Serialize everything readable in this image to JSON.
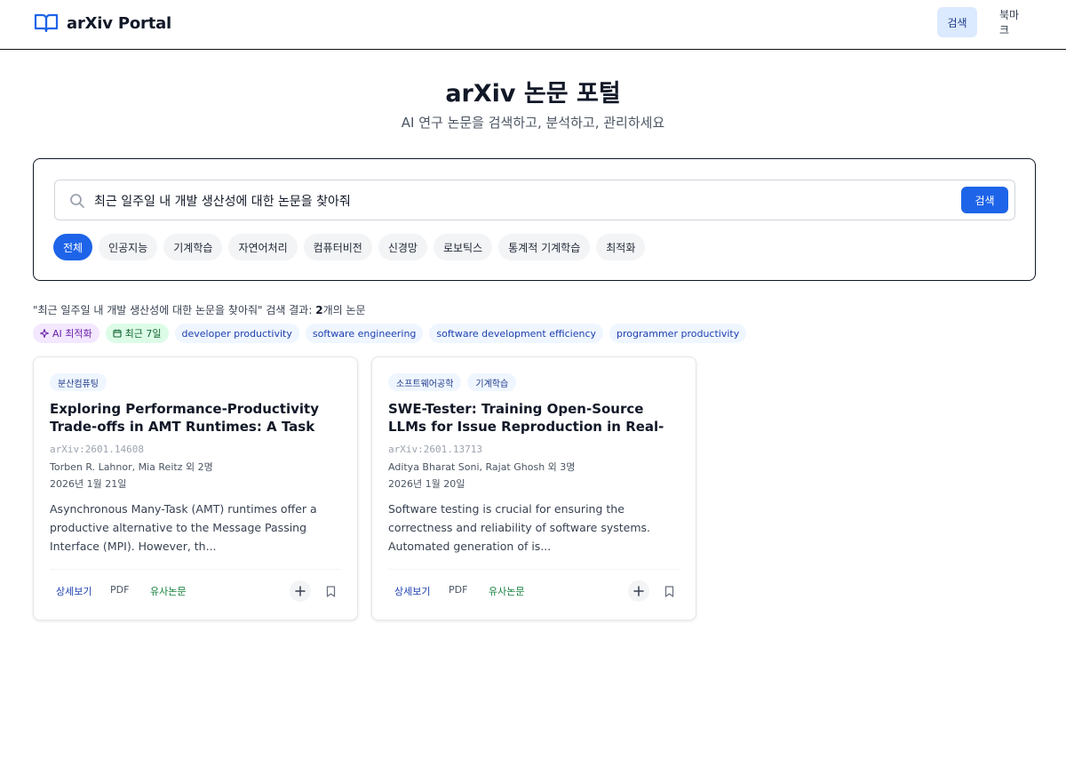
{
  "header": {
    "brand": "arXiv Portal",
    "nav": [
      {
        "label": "검색",
        "active": true
      },
      {
        "label": "북마크",
        "active": false
      }
    ]
  },
  "hero": {
    "title": "arXiv 논문 포털",
    "subtitle": "AI 연구 논문을 검색하고, 분석하고, 관리하세요"
  },
  "search": {
    "query": "최근 일주일 내 개발 생산성에 대한 논문을 찾아줘",
    "button_label": "검색",
    "categories": [
      "전체",
      "인공지능",
      "기계학습",
      "자연어처리",
      "컴퓨터비전",
      "신경망",
      "로보틱스",
      "통계적 기계학습",
      "최적화"
    ],
    "active_category": "전체"
  },
  "results": {
    "summary_prefix": "\"최근 일주일 내 개발 생산성에 대한 논문을 찾아줘\" 검색 결과: ",
    "count": "2",
    "summary_suffix": "개의 논문",
    "chips": {
      "ai": "AI 최적화",
      "date": "최근 7일",
      "keywords": [
        "developer productivity",
        "software engineering",
        "software development efficiency",
        "programmer productivity"
      ]
    }
  },
  "papers": [
    {
      "tags": [
        "분산컴퓨팅"
      ],
      "title": "Exploring Performance-Productivity Trade-offs in AMT Runtimes: A Task Bench Study …",
      "id": "arXiv:2601.14608",
      "authors": "Torben R. Lahnor, Mia Reitz 외 2명",
      "date": "2026년 1월 21일",
      "abstract": "Asynchronous Many-Task (AMT) runtimes offer a productive alternative to the Message Passing Interface (MPI). However, th...",
      "actions": {
        "detail": "상세보기",
        "pdf": "PDF",
        "similar": "유사논문"
      }
    },
    {
      "tags": [
        "소프트웨어공학",
        "기계학습"
      ],
      "title": "SWE-Tester: Training Open-Source LLMs for Issue Reproduction in Real-World…",
      "id": "arXiv:2601.13713",
      "authors": "Aditya Bharat Soni, Rajat Ghosh 외 3명",
      "date": "2026년 1월 20일",
      "abstract": "Software testing is crucial for ensuring the correctness and reliability of software systems. Automated generation of is...",
      "actions": {
        "detail": "상세보기",
        "pdf": "PDF",
        "similar": "유사논문"
      }
    }
  ],
  "icons": {
    "brand": "book-open-icon",
    "search": "search-icon",
    "ai": "sparkle-icon",
    "date": "calendar-icon",
    "add": "plus-icon",
    "bookmark": "bookmark-icon"
  },
  "colors": {
    "primary": "#1d64e8",
    "nav_active_bg": "#dbeafe",
    "ai_chip_bg": "#f3e8ff",
    "date_chip_bg": "#dcfce7",
    "keyword_chip_bg": "#eff6ff"
  }
}
